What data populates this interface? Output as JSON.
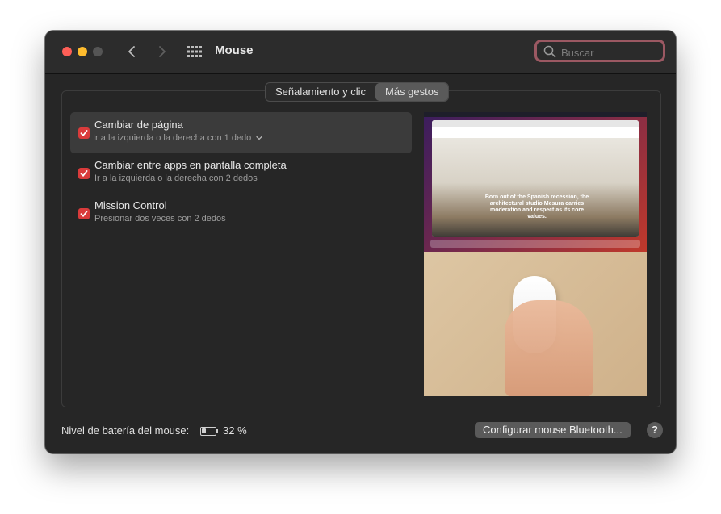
{
  "window": {
    "title": "Mouse",
    "search_placeholder": "Buscar"
  },
  "tabs": [
    {
      "label": "Señalamiento y clic",
      "active": false
    },
    {
      "label": "Más gestos",
      "active": true
    }
  ],
  "gestures": [
    {
      "title": "Cambiar de página",
      "subtitle": "Ir a la izquierda o la derecha con 1 dedo",
      "checked": true,
      "selected": true
    },
    {
      "title": "Cambiar entre apps en pantalla completa",
      "subtitle": "Ir a la izquierda o la derecha con 2 dedos",
      "checked": true,
      "selected": false
    },
    {
      "title": "Mission Control",
      "subtitle": "Presionar dos veces con 2 dedos",
      "checked": true,
      "selected": false
    }
  ],
  "preview": {
    "headline": "Born out of the Spanish recession, the architectural studio Mesura carries moderation and respect as its core values."
  },
  "footer": {
    "battery_label": "Nivel de batería del mouse:",
    "battery_percent": "32 %",
    "battery_level": 0.32,
    "bluetooth_button": "Configurar mouse Bluetooth...",
    "help": "?"
  },
  "colors": {
    "window_bg": "#262626",
    "checkbox_accent": "#d93b3b",
    "search_focus": "#9b5862"
  }
}
